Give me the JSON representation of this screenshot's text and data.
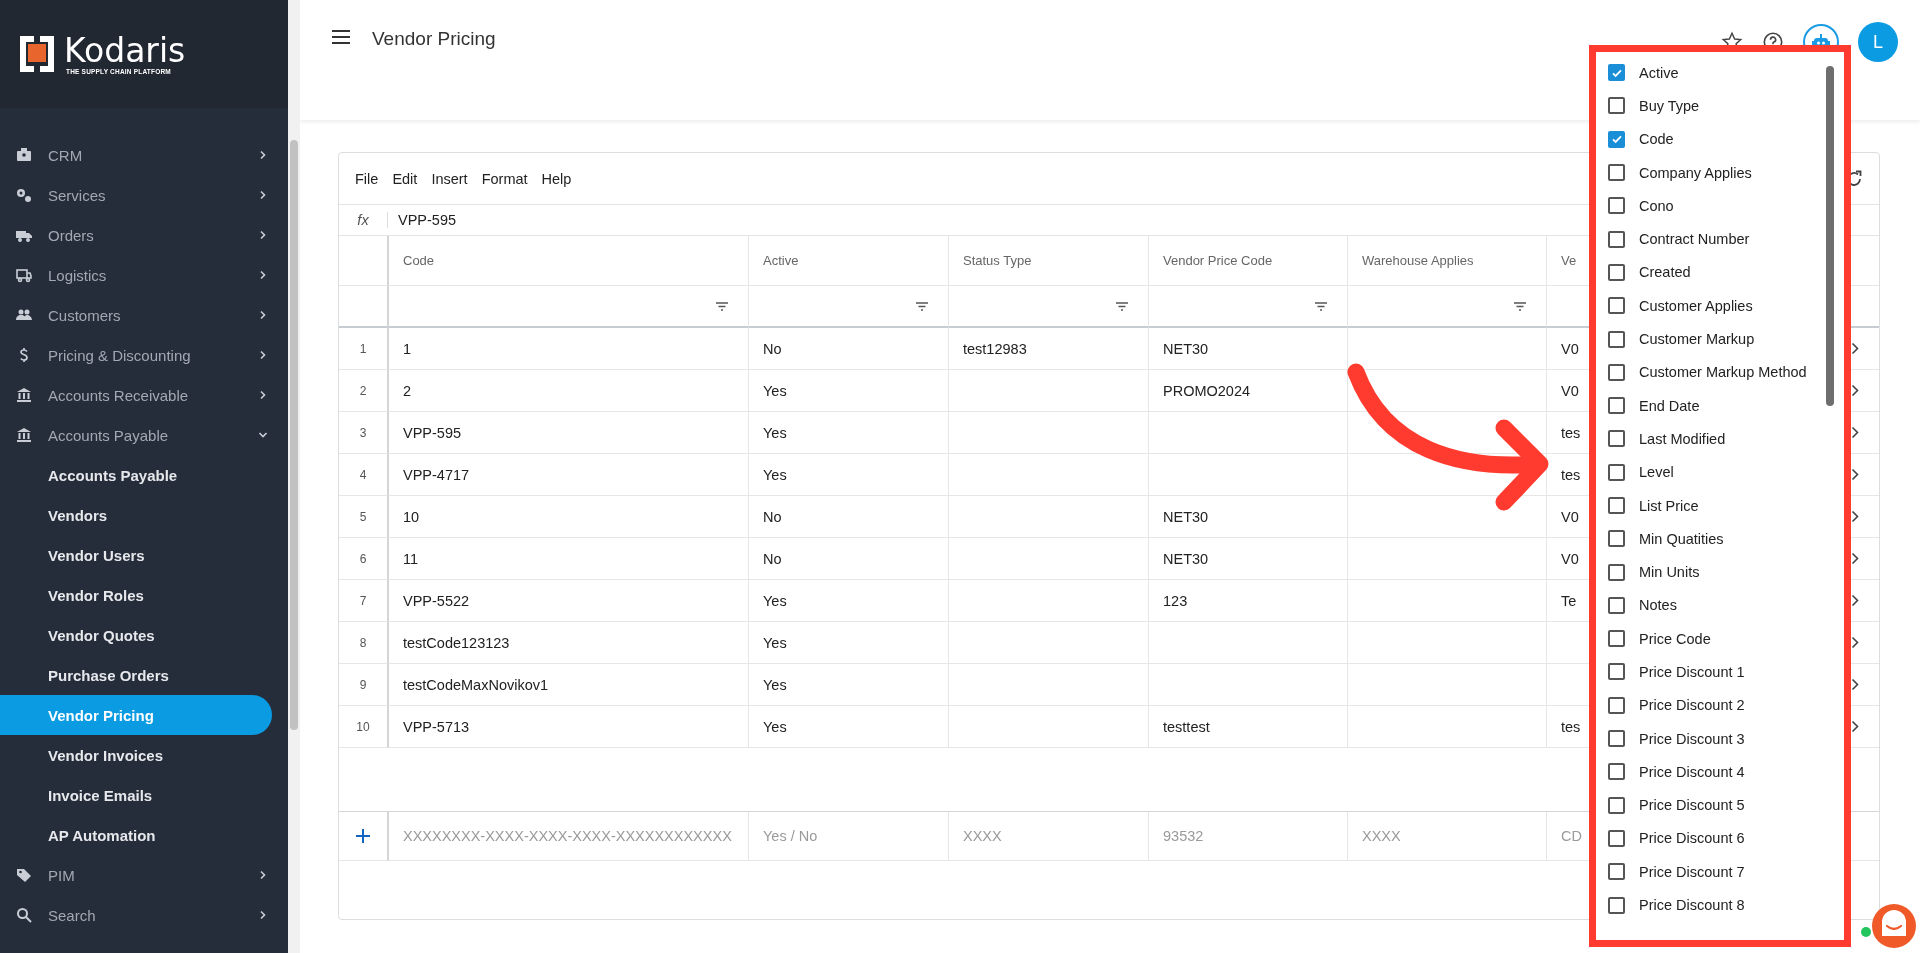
{
  "sidebar": {
    "logo": {
      "name": "Kodaris",
      "tagline": "THE SUPPLY CHAIN PLATFORM"
    },
    "items": [
      {
        "label": "CRM",
        "expanded": false
      },
      {
        "label": "Services",
        "expanded": false
      },
      {
        "label": "Orders",
        "expanded": false
      },
      {
        "label": "Logistics",
        "expanded": false
      },
      {
        "label": "Customers",
        "expanded": false
      },
      {
        "label": "Pricing & Discounting",
        "expanded": false
      },
      {
        "label": "Accounts Receivable",
        "expanded": false
      },
      {
        "label": "Accounts Payable",
        "expanded": true,
        "children": [
          {
            "label": "Accounts Payable",
            "selected": false
          },
          {
            "label": "Vendors",
            "selected": false
          },
          {
            "label": "Vendor Users",
            "selected": false
          },
          {
            "label": "Vendor Roles",
            "selected": false
          },
          {
            "label": "Vendor Quotes",
            "selected": false
          },
          {
            "label": "Purchase Orders",
            "selected": false
          },
          {
            "label": "Vendor Pricing",
            "selected": true
          },
          {
            "label": "Vendor Invoices",
            "selected": false
          },
          {
            "label": "Invoice Emails",
            "selected": false
          },
          {
            "label": "AP Automation",
            "selected": false
          }
        ]
      },
      {
        "label": "PIM",
        "expanded": false
      },
      {
        "label": "Search",
        "expanded": false
      }
    ]
  },
  "header": {
    "title": "Vendor Pricing",
    "avatar": "L"
  },
  "sheet": {
    "menu": [
      "File",
      "Edit",
      "Insert",
      "Format",
      "Help"
    ],
    "formula": {
      "label": "fx",
      "value": "VPP-595"
    },
    "columns": [
      {
        "label": "Code"
      },
      {
        "label": "Active"
      },
      {
        "label": "Status Type"
      },
      {
        "label": "Vendor Price Code"
      },
      {
        "label": "Warehouse Applies"
      },
      {
        "label": "Ve"
      }
    ],
    "rows": [
      {
        "number": "1",
        "code": "1",
        "active": "No",
        "status_type": "test12983",
        "vendor_price_code": "NET30",
        "column_6": "V0"
      },
      {
        "number": "2",
        "code": "2",
        "active": "Yes",
        "vendor_price_code": "PROMO2024",
        "column_6": "V0"
      },
      {
        "number": "3",
        "code": "VPP-595",
        "active": "Yes",
        "column_6": "tes"
      },
      {
        "number": "4",
        "code": "VPP-4717",
        "active": "Yes",
        "column_6": "tes"
      },
      {
        "number": "5",
        "code": "10",
        "active": "No",
        "vendor_price_code": "NET30",
        "column_6": "V0"
      },
      {
        "number": "6",
        "code": "11",
        "active": "No",
        "vendor_price_code": "NET30",
        "column_6": "V0"
      },
      {
        "number": "7",
        "code": "VPP-5522",
        "active": "Yes",
        "vendor_price_code": "123",
        "column_6": "Te"
      },
      {
        "number": "8",
        "code": "testCode123123",
        "active": "Yes"
      },
      {
        "number": "9",
        "code": "testCodeMaxNovikov1",
        "active": "Yes"
      },
      {
        "number": "10",
        "code": "VPP-5713",
        "active": "Yes",
        "vendor_price_code": "testtest",
        "column_6": "tes"
      }
    ],
    "new_row": {
      "code": "XXXXXXXX-XXXX-XXXX-XXXX-XXXXXXXXXXXX",
      "active": "Yes / No",
      "status_type": "XXXX",
      "vendor_price_code": "93532",
      "warehouse_applies": "XXXX",
      "column_6": "CD"
    }
  },
  "column_chooser": [
    {
      "label": "Active",
      "checked": true
    },
    {
      "label": "Buy Type",
      "checked": false
    },
    {
      "label": "Code",
      "checked": true
    },
    {
      "label": "Company Applies",
      "checked": false
    },
    {
      "label": "Cono",
      "checked": false
    },
    {
      "label": "Contract Number",
      "checked": false
    },
    {
      "label": "Created",
      "checked": false
    },
    {
      "label": "Customer Applies",
      "checked": false
    },
    {
      "label": "Customer Markup",
      "checked": false
    },
    {
      "label": "Customer Markup Method",
      "checked": false
    },
    {
      "label": "End Date",
      "checked": false
    },
    {
      "label": "Last Modified",
      "checked": false
    },
    {
      "label": "Level",
      "checked": false
    },
    {
      "label": "List Price",
      "checked": false
    },
    {
      "label": "Min Quatities",
      "checked": false
    },
    {
      "label": "Min Units",
      "checked": false
    },
    {
      "label": "Notes",
      "checked": false
    },
    {
      "label": "Price Code",
      "checked": false
    },
    {
      "label": "Price Discount 1",
      "checked": false
    },
    {
      "label": "Price Discount 2",
      "checked": false
    },
    {
      "label": "Price Discount 3",
      "checked": false
    },
    {
      "label": "Price Discount 4",
      "checked": false
    },
    {
      "label": "Price Discount 5",
      "checked": false
    },
    {
      "label": "Price Discount 6",
      "checked": false
    },
    {
      "label": "Price Discount 7",
      "checked": false
    },
    {
      "label": "Price Discount 8",
      "checked": false
    }
  ]
}
